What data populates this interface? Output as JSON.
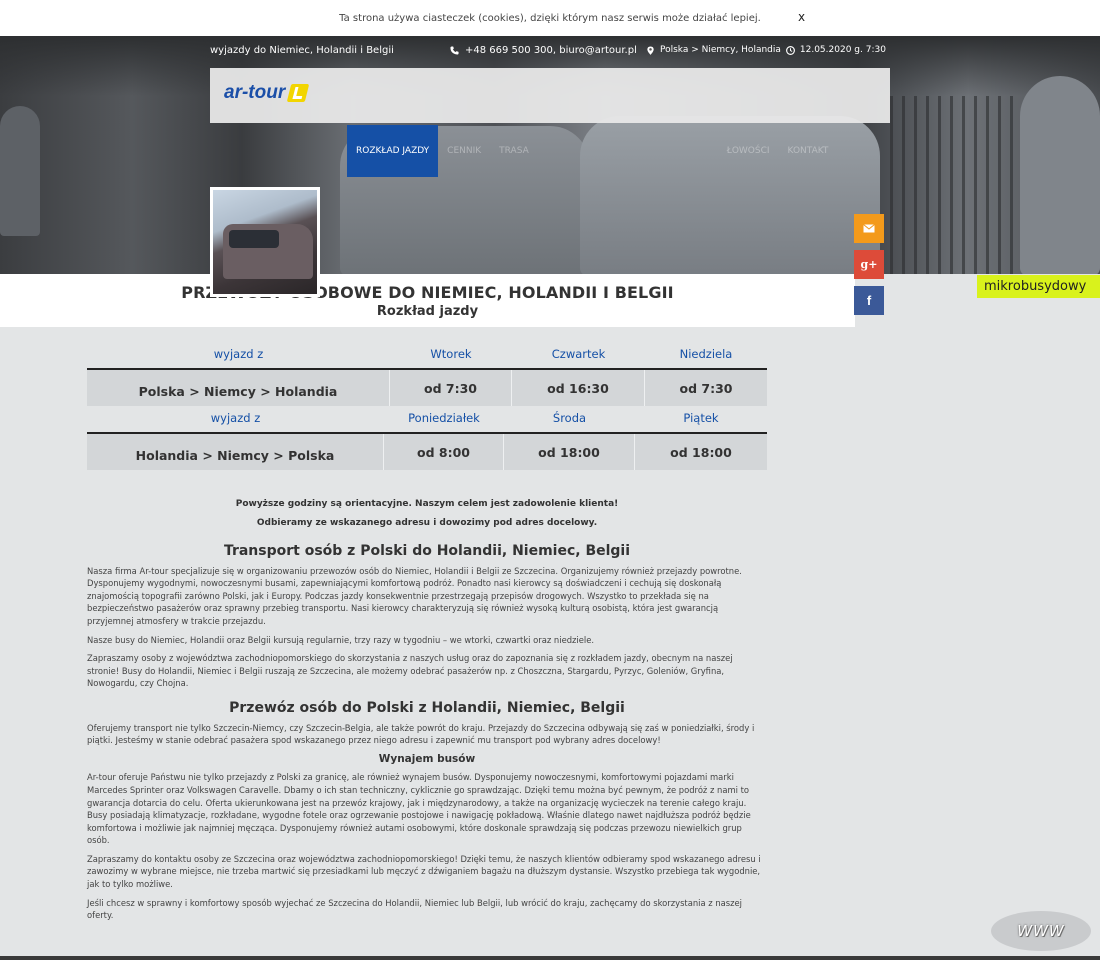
{
  "cookie": {
    "text": "Ta strona używa ciasteczek (cookies), dzięki którym nasz serwis może działać lepiej.",
    "close": "x"
  },
  "header": {
    "tagline": "wyjazdy do Niemiec, Holandii i Belgii",
    "contact": "+48 669 500 300, biuro@artour.pl",
    "route": "Polska > Niemcy, Holandia",
    "datetime": "12.05.2020 g. 7:30",
    "logo": "ar-tour"
  },
  "nav": {
    "items": [
      "ROZKŁAD JAZDY",
      "CENNIK",
      "TRASA",
      "",
      "",
      "",
      "ŁOWOŚCI",
      "KONTAKT"
    ]
  },
  "side_tag": "mikrobusydowy",
  "title": {
    "main": "PRZEWOZY OSOBOWE DO NIEMIEC, HOLANDII I BELGII",
    "sub": "Rozkład jazdy"
  },
  "timetable": [
    {
      "header": [
        "wyjazd z",
        "Wtorek",
        "Czwartek",
        "Niedziela"
      ],
      "route": "Polska > Niemcy > Holandia",
      "times": [
        "od 7:30",
        "od 16:30",
        "od 7:30"
      ]
    },
    {
      "header": [
        "wyjazd z",
        "Poniedziałek",
        "Środa",
        "Piątek"
      ],
      "route": "Holandia > Niemcy > Polska",
      "times": [
        "od 8:00",
        "od 18:00",
        "od 18:00"
      ]
    }
  ],
  "notes": [
    "Powyższe godziny są orientacyjne. Naszym celem jest zadowolenie klienta!",
    "Odbieramy ze wskazanego adresu i dowozimy pod adres docelowy."
  ],
  "section1": {
    "heading": "Transport osób z Polski do Holandii, Niemiec, Belgii",
    "p1": "Nasza firma Ar-tour specjalizuje się w organizowaniu przewozów osób do Niemiec, Holandii i Belgii ze Szczecina. Organizujemy również przejazdy powrotne. Dysponujemy wygodnymi, nowoczesnymi busami, zapewniającymi komfortową podróż. Ponadto nasi kierowcy są doświadczeni i cechują się doskonałą znajomością topografii zarówno Polski, jak i Europy. Podczas jazdy konsekwentnie przestrzegają przepisów drogowych. Wszystko to przekłada się na bezpieczeństwo pasażerów oraz sprawny przebieg transportu. Nasi kierowcy charakteryzują się również wysoką kulturą osobistą, która jest gwarancją przyjemnej atmosfery w trakcie przejazdu.",
    "p2": "Nasze busy do Niemiec, Holandii oraz Belgii kursują regularnie, trzy razy w tygodniu – we wtorki, czwartki oraz niedziele.",
    "p3": "Zapraszamy osoby z województwa zachodniopomorskiego do skorzystania z naszych usług oraz do zapoznania się z rozkładem jazdy, obecnym na naszej stronie! Busy do Holandii, Niemiec i Belgii ruszają ze Szczecina, ale możemy odebrać pasażerów np. z Choszczna, Stargardu, Pyrzyc, Goleniów, Gryfina, Nowogardu, czy Chojna."
  },
  "section2": {
    "heading": "Przewóz osób do Polski z Holandii, Niemiec, Belgii",
    "p1": "Oferujemy transport nie tylko Szczecin-Niemcy, czy Szczecin-Belgia, ale także powrót do kraju. Przejazdy do Szczecina odbywają się zaś w poniedziałki, środy i piątki. Jesteśmy w stanie odebrać pasażera spod wskazanego przez niego adresu i zapewnić mu transport pod wybrany adres docelowy!",
    "subheading": "Wynajem busów",
    "p2": "Ar-tour oferuje Państwu nie tylko przejazdy z Polski za granicę, ale również wynajem busów. Dysponujemy nowoczesnymi, komfortowymi pojazdami marki Marcedes Sprinter oraz Volkswagen Caravelle. Dbamy o ich stan techniczny, cyklicznie go sprawdzając. Dzięki temu można być pewnym, że podróż z nami to gwarancja dotarcia do celu. Oferta ukierunkowana jest na przewóz krajowy, jak i międzynarodowy, a także na organizację wycieczek na terenie całego kraju. Busy posiadają klimatyzacje, rozkładane, wygodne fotele oraz ogrzewanie postojowe i nawigację pokładową. Właśnie dlatego nawet najdłuższa podróż będzie komfortowa i możliwie jak najmniej męcząca. Dysponujemy również autami osobowymi, które doskonale sprawdzają się podczas przewozu niewielkich grup osób.",
    "p3": "Zapraszamy do kontaktu osoby ze Szczecina oraz województwa zachodniopomorskiego! Dzięki temu, że naszych klientów odbieramy spod wskazanego adresu i zawozimy w wybrane miejsce, nie trzeba martwić się przesiadkami lub męczyć z dźwiganiem bagażu na dłuższym dystansie. Wszystko przebiega tak wygodnie, jak to tylko możliwe.",
    "p4": "Jeśli chcesz w sprawny i komfortowy sposób wyjechać ze Szczecina do Holandii, Niemiec lub Belgii, lub wrócić do kraju, zachęcamy do skorzystania z naszej oferty."
  },
  "badge": "WWW"
}
